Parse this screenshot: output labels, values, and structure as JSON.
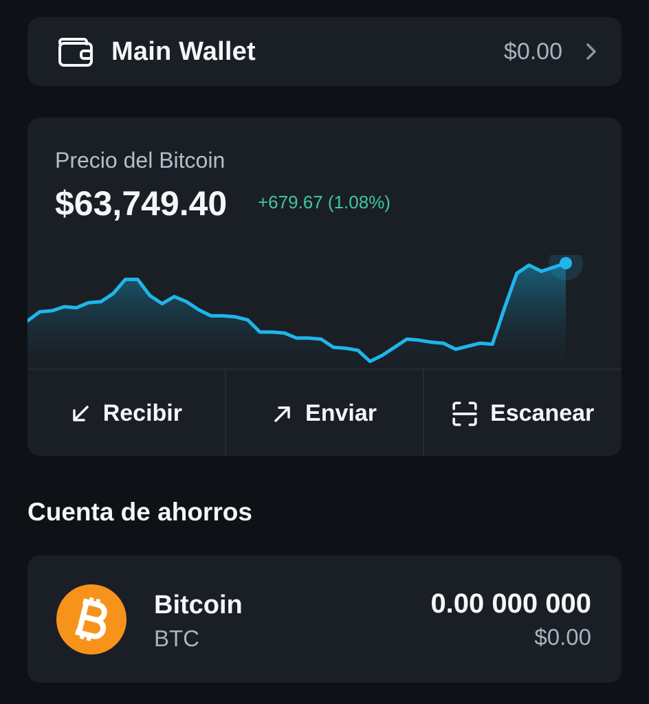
{
  "wallet": {
    "name": "Main Wallet",
    "balance": "$0.00"
  },
  "price": {
    "label": "Precio del Bitcoin",
    "value": "$63,749.40",
    "change": "+679.67 (1.08%)"
  },
  "chart_data": {
    "type": "area",
    "values": [
      63235,
      63280,
      63285,
      63305,
      63300,
      63325,
      63330,
      63370,
      63440,
      63440,
      63360,
      63320,
      63355,
      63330,
      63290,
      63260,
      63260,
      63255,
      63240,
      63180,
      63180,
      63175,
      63150,
      63150,
      63145,
      63105,
      63100,
      63090,
      63035,
      63065,
      63105,
      63145,
      63140,
      63130,
      63125,
      63095,
      63110,
      63125,
      63120,
      63300,
      63470,
      63510,
      63480,
      63500,
      63520
    ],
    "ylim": [
      63000,
      63560
    ],
    "grid": false,
    "colors": {
      "line": "#1fb6ea",
      "fill_top": "#1b6d8a",
      "fill_bottom": "#1a1f26"
    }
  },
  "actions": [
    {
      "label": "Recibir",
      "icon": "arrow-down-left-icon"
    },
    {
      "label": "Enviar",
      "icon": "arrow-up-right-icon"
    },
    {
      "label": "Escanear",
      "icon": "scan-icon"
    }
  ],
  "savings": {
    "title": "Cuenta de ahorros",
    "asset": {
      "name": "Bitcoin",
      "symbol": "BTC",
      "amount": "0.00 000 000",
      "fiat": "$0.00",
      "logo_color": "#f7931a"
    }
  }
}
